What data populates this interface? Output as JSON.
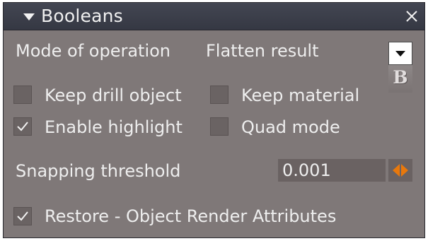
{
  "panel": {
    "title": "Booleans",
    "collapse_icon": "triangle-down-icon",
    "close_icon": "close-x-icon"
  },
  "mode": {
    "label": "Mode of operation",
    "value": "Flatten result",
    "dropdown_icon": "chevron-down-icon",
    "button_label": "B"
  },
  "options": {
    "keep_drill_object": {
      "label": "Keep drill object",
      "checked": false
    },
    "keep_material": {
      "label": "Keep material",
      "checked": false
    },
    "enable_highlight": {
      "label": "Enable highlight",
      "checked": true
    },
    "quad_mode": {
      "label": "Quad mode",
      "checked": false
    },
    "restore_attributes": {
      "label": "Restore - Object Render Attributes",
      "checked": true
    }
  },
  "snapping": {
    "label": "Snapping threshold",
    "value": "0.001",
    "spinner_icon": "left-right-arrows-icon"
  },
  "colors": {
    "panel_bg": "#7f7878",
    "titlebar_bg": "#3d404b",
    "checkbox_bg": "#6a6363",
    "field_bg": "#6a6262",
    "spinner_accent": "#e8780c",
    "text": "#eeeeee"
  }
}
